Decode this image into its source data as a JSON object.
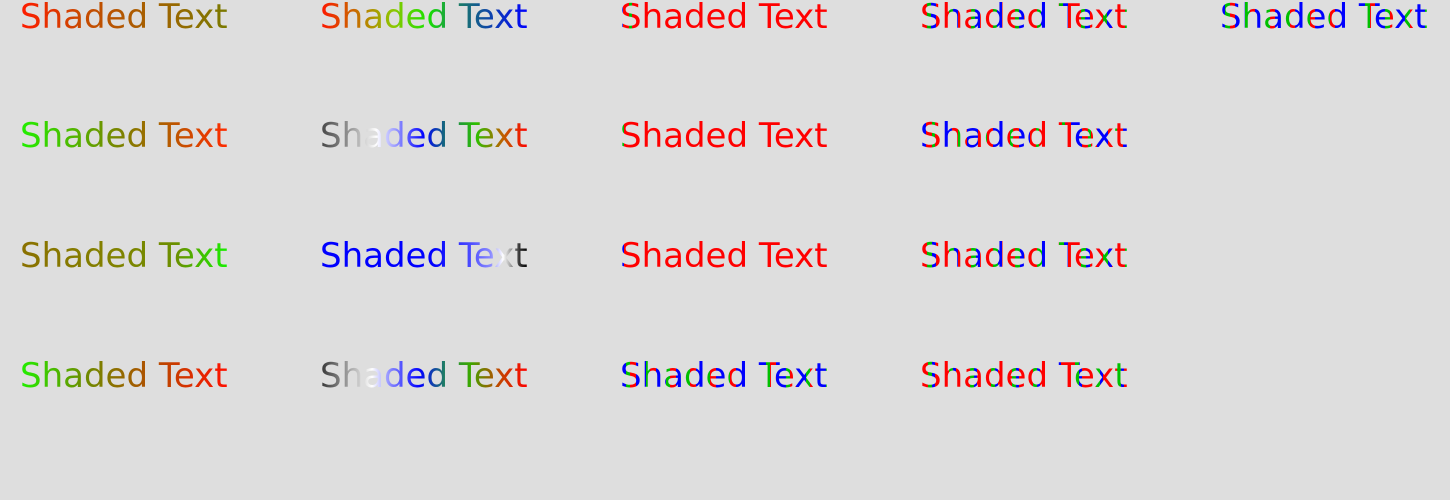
{
  "samples": [
    [
      "Shaded Text",
      "Shaded Text",
      "Shaded Text",
      "Shaded Text",
      "Shaded Text"
    ],
    [
      "Shaded Text",
      "Shaded Text",
      "Shaded Text",
      "Shaded Text"
    ],
    [
      "Shaded Text",
      "Shaded Text",
      "Shaded Text",
      "Shaded Text"
    ],
    [
      "Shaded Text",
      "Shaded Text",
      "Shaded Text",
      "Shaded Text"
    ]
  ],
  "colors": {
    "background": "#dedede",
    "red": "#ff0000",
    "green": "#00c000",
    "blue": "#0000ff",
    "olive": "#7a7a00",
    "white": "#ffffff",
    "black": "#000000"
  }
}
